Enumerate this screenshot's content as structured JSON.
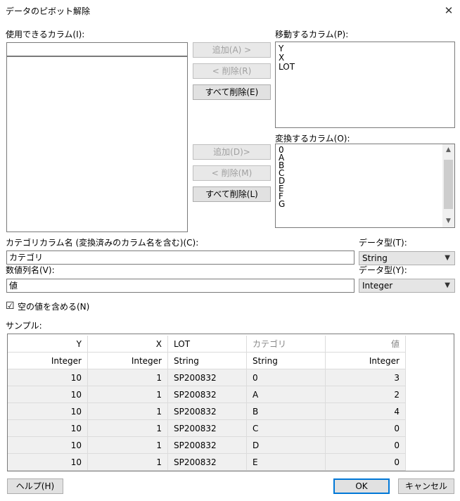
{
  "window": {
    "title": "データのピボット解除",
    "close_glyph": "✕"
  },
  "available": {
    "label": "使用できるカラム(I):",
    "search_value": ""
  },
  "buttons_top": {
    "add": "追加(A) >",
    "remove": "< 削除(R)",
    "remove_all": "すべて削除(E)"
  },
  "moved": {
    "label": "移動するカラム(P):",
    "items": [
      "Y",
      "X",
      "LOT"
    ]
  },
  "transform": {
    "label": "変換するカラム(O):",
    "items": [
      "0",
      "A",
      "B",
      "C",
      "D",
      "E",
      "F",
      "G"
    ]
  },
  "buttons_mid": {
    "add": "追加(D)>",
    "remove": "< 削除(M)",
    "remove_all": "すべて削除(L)"
  },
  "category": {
    "label": "カテゴリカラム名 (変換済みのカラム名を含む)(C):",
    "value": "カテゴリ",
    "type_label": "データ型(T):",
    "type_value": "String"
  },
  "value_col": {
    "label": "数値列名(V):",
    "value": "値",
    "type_label": "データ型(Y):",
    "type_value": "Integer"
  },
  "include_empty": {
    "label": "空の値を含める(N)",
    "checked": true,
    "check_glyph": "☑"
  },
  "sample": {
    "label": "サンプル:",
    "headers": [
      "Y",
      "X",
      "LOT",
      "カテゴリ",
      "値"
    ],
    "types": [
      "Integer",
      "Integer",
      "String",
      "String",
      "Integer"
    ],
    "rows": [
      [
        "10",
        "1",
        "SP200832",
        "0",
        "3"
      ],
      [
        "10",
        "1",
        "SP200832",
        "A",
        "2"
      ],
      [
        "10",
        "1",
        "SP200832",
        "B",
        "4"
      ],
      [
        "10",
        "1",
        "SP200832",
        "C",
        "0"
      ],
      [
        "10",
        "1",
        "SP200832",
        "D",
        "0"
      ],
      [
        "10",
        "1",
        "SP200832",
        "E",
        "0"
      ]
    ]
  },
  "footer": {
    "help": "ヘルプ(H)",
    "ok": "OK",
    "cancel": "キャンセル"
  }
}
